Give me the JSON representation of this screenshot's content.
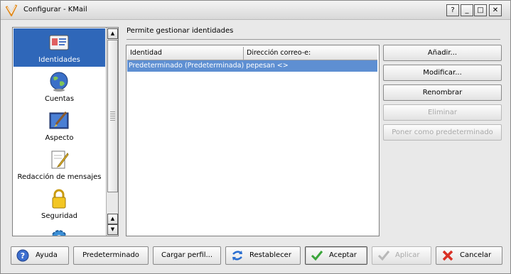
{
  "window": {
    "title": "Configurar - KMail",
    "controls": {
      "help": "?",
      "minimize": "_",
      "maximize": "□",
      "close": "✕"
    }
  },
  "sidebar": {
    "items": [
      {
        "label": "Identidades",
        "icon": "identities-card-icon",
        "active": true
      },
      {
        "label": "Cuentas",
        "icon": "globe-accounts-icon",
        "active": false
      },
      {
        "label": "Aspecto",
        "icon": "paintbrush-appearance-icon",
        "active": false
      },
      {
        "label": "Redacción de mensajes",
        "icon": "pencil-compose-icon",
        "active": false
      },
      {
        "label": "Seguridad",
        "icon": "padlock-security-icon",
        "active": false
      },
      {
        "label": "",
        "icon": "gear-misc-icon",
        "active": false
      }
    ]
  },
  "main": {
    "section_title": "Permite gestionar identidades",
    "table": {
      "columns": [
        "Identidad",
        "Dirección correo-e:"
      ],
      "rows": [
        {
          "text": "Predeterminado (Predeterminada) pepesan <>",
          "selected": true
        }
      ]
    },
    "buttons": [
      {
        "label": "Añadir...",
        "enabled": true
      },
      {
        "label": "Modificar...",
        "enabled": true
      },
      {
        "label": "Renombrar",
        "enabled": true
      },
      {
        "label": "Eliminar",
        "enabled": false
      },
      {
        "label": "Poner como predeterminado",
        "enabled": false
      }
    ]
  },
  "footer": {
    "help": "Ayuda",
    "defaults": "Predeterminado",
    "load_profile": "Cargar perfil...",
    "reset": "Restablecer",
    "ok": "Aceptar",
    "apply": "Aplicar",
    "cancel": "Cancelar"
  },
  "colors": {
    "selection": "#2f67b9",
    "row_selection": "#5e8fd2",
    "cancel_red": "#d93025",
    "ok_green": "#3aa53a"
  }
}
